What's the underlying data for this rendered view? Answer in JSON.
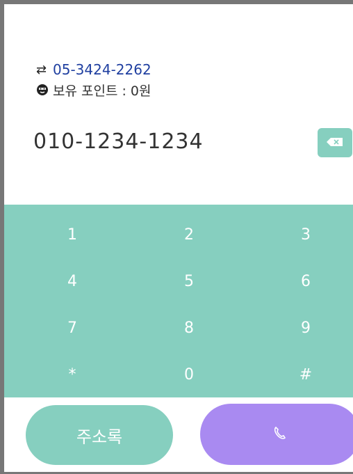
{
  "caller": {
    "number": "05-3424-2262",
    "points": "보유 포인트 : 0원"
  },
  "dialed_number": "010-1234-1234",
  "keypad": {
    "keys": [
      "1",
      "2",
      "3",
      "4",
      "5",
      "6",
      "7",
      "8",
      "9",
      "*",
      "0",
      "#"
    ]
  },
  "actions": {
    "contacts_label": "주소록"
  },
  "icons": [
    "swap-arrows-icon",
    "face-icon",
    "backspace-icon",
    "phone-icon"
  ],
  "colors": {
    "keypad_bg": "#86cfbf",
    "call_button": "#a98af1",
    "number_link": "#1f3fa0"
  }
}
